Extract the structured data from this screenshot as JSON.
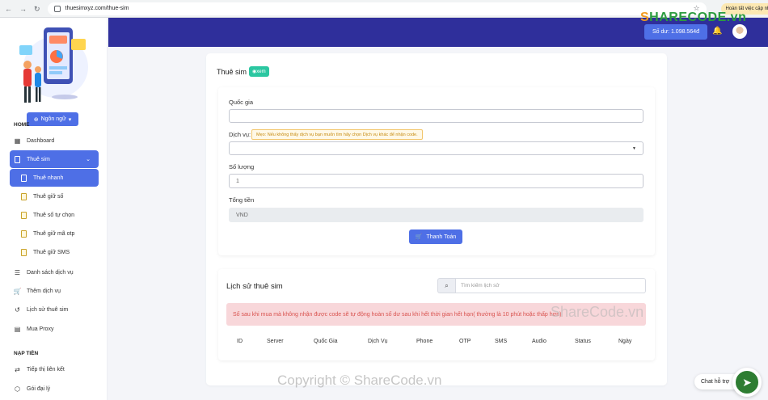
{
  "browser": {
    "url": "thuesimxyz.com/thue-sim",
    "update_label": "Hoàn tất việc cập nhật"
  },
  "sidebar": {
    "lang_button": "Ngôn ngữ",
    "home_label": "HOME",
    "dashboard": "Dashboard",
    "rent_sim": "Thuê sim",
    "sub_items": [
      "Thuê nhanh",
      "Thuê giữ số",
      "Thuê số tự chọn",
      "Thuê giữ mã otp",
      "Thuê giữ SMS"
    ],
    "service_list": "Danh sách dịch vụ",
    "add_service": "Thêm dịch vụ",
    "history": "Lịch sử thuê sim",
    "proxy": "Mua Proxy",
    "topup_label": "NẠP TIỀN",
    "affiliate": "Tiếp thị liên kết",
    "agent_pack": "Gói đại lý"
  },
  "header": {
    "balance": "Số dư: 1.098.564đ"
  },
  "form": {
    "title": "Thuê sim",
    "badge": "xem",
    "country_label": "Quốc gia",
    "country_value": "",
    "service_label": "Dịch vụ:",
    "service_tip": "Mẹo: Nếu không thấy dịch vụ bạn muốn tìm hãy chọn Dịch vụ khác để nhận code.",
    "service_value": "",
    "quantity_label": "Số lượng",
    "quantity_value": "1",
    "total_label": "Tổng tiền",
    "total_value": "VND",
    "pay_button": "Thanh Toán"
  },
  "history": {
    "title": "Lịch sử thuê sim",
    "search_placeholder": "Tìm kiếm lịch sử",
    "alert": "Số sau khi mua mà không nhận được code sẽ tự động hoàn số dư sau khi hết thời gian hết hạn( thường là 10 phút hoặc thấp hơn)",
    "columns": [
      "ID",
      "Server",
      "Quốc Gia",
      "Dịch Vụ",
      "Phone",
      "OTP",
      "SMS",
      "Audio",
      "Status",
      "Ngày"
    ]
  },
  "watermarks": {
    "logo_prefix": "S",
    "logo_text": "HARECODE.vn",
    "middle": "ShareCode.vn",
    "bottom": "Copyright © ShareCode.vn"
  },
  "chat": {
    "label": "Chat hỗ trợ"
  },
  "colors": {
    "primary": "#4e6fe6",
    "header": "#2f2f9b",
    "badge": "#2bc7a1",
    "alert_bg": "#f8d7da",
    "alert_text": "#d9534f"
  }
}
